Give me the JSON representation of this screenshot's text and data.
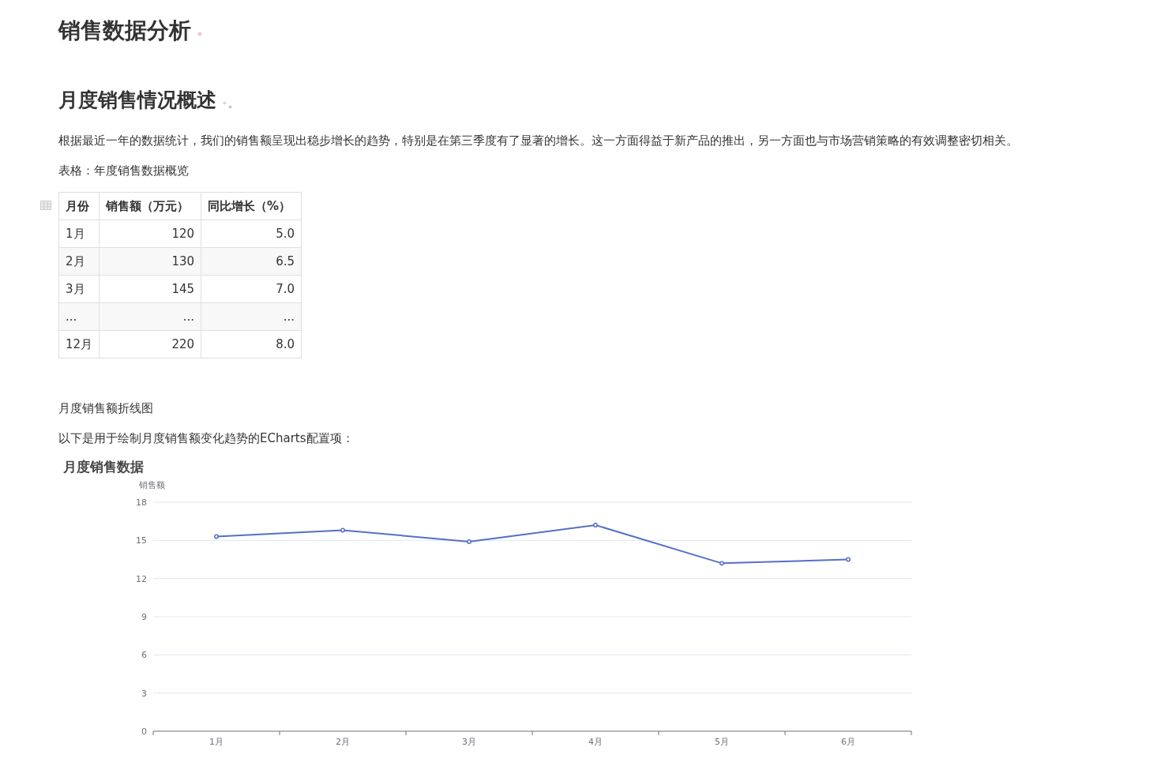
{
  "title": "销售数据分析",
  "section": {
    "heading": "月度销售情况概述",
    "paragraph": "根据最近一年的数据统计，我们的销售额呈现出稳步增长的趋势，特别是在第三季度有了显著的增长。这一方面得益于新产品的推出，另一方面也与市场营销策略的有效调整密切相关。",
    "table_caption": "表格：年度销售数据概览",
    "table": {
      "columns": [
        "月份",
        "销售额（万元）",
        "同比增长（%）"
      ],
      "rows": [
        [
          "1月",
          "120",
          "5.0"
        ],
        [
          "2月",
          "130",
          "6.5"
        ],
        [
          "3月",
          "145",
          "7.0"
        ],
        [
          "...",
          "...",
          "..."
        ],
        [
          "12月",
          "220",
          "8.0"
        ]
      ]
    },
    "chart_caption": "月度销售额折线图",
    "chart_intro": "以下是用于绘制月度销售额变化趋势的ECharts配置项：",
    "chart_data": {
      "type": "line",
      "title": "月度销售数据",
      "ylabel": "销售额",
      "categories": [
        "1月",
        "2月",
        "3月",
        "4月",
        "5月",
        "6月"
      ],
      "series": [
        {
          "color": "#5470c6",
          "marker": true,
          "values": [
            15.3,
            15.8,
            14.9,
            16.2,
            13.2,
            13.5
          ]
        }
      ],
      "grid": true,
      "ylim": [
        0,
        18
      ],
      "yticks": [
        0,
        3,
        6,
        9,
        12,
        15,
        18
      ]
    }
  }
}
